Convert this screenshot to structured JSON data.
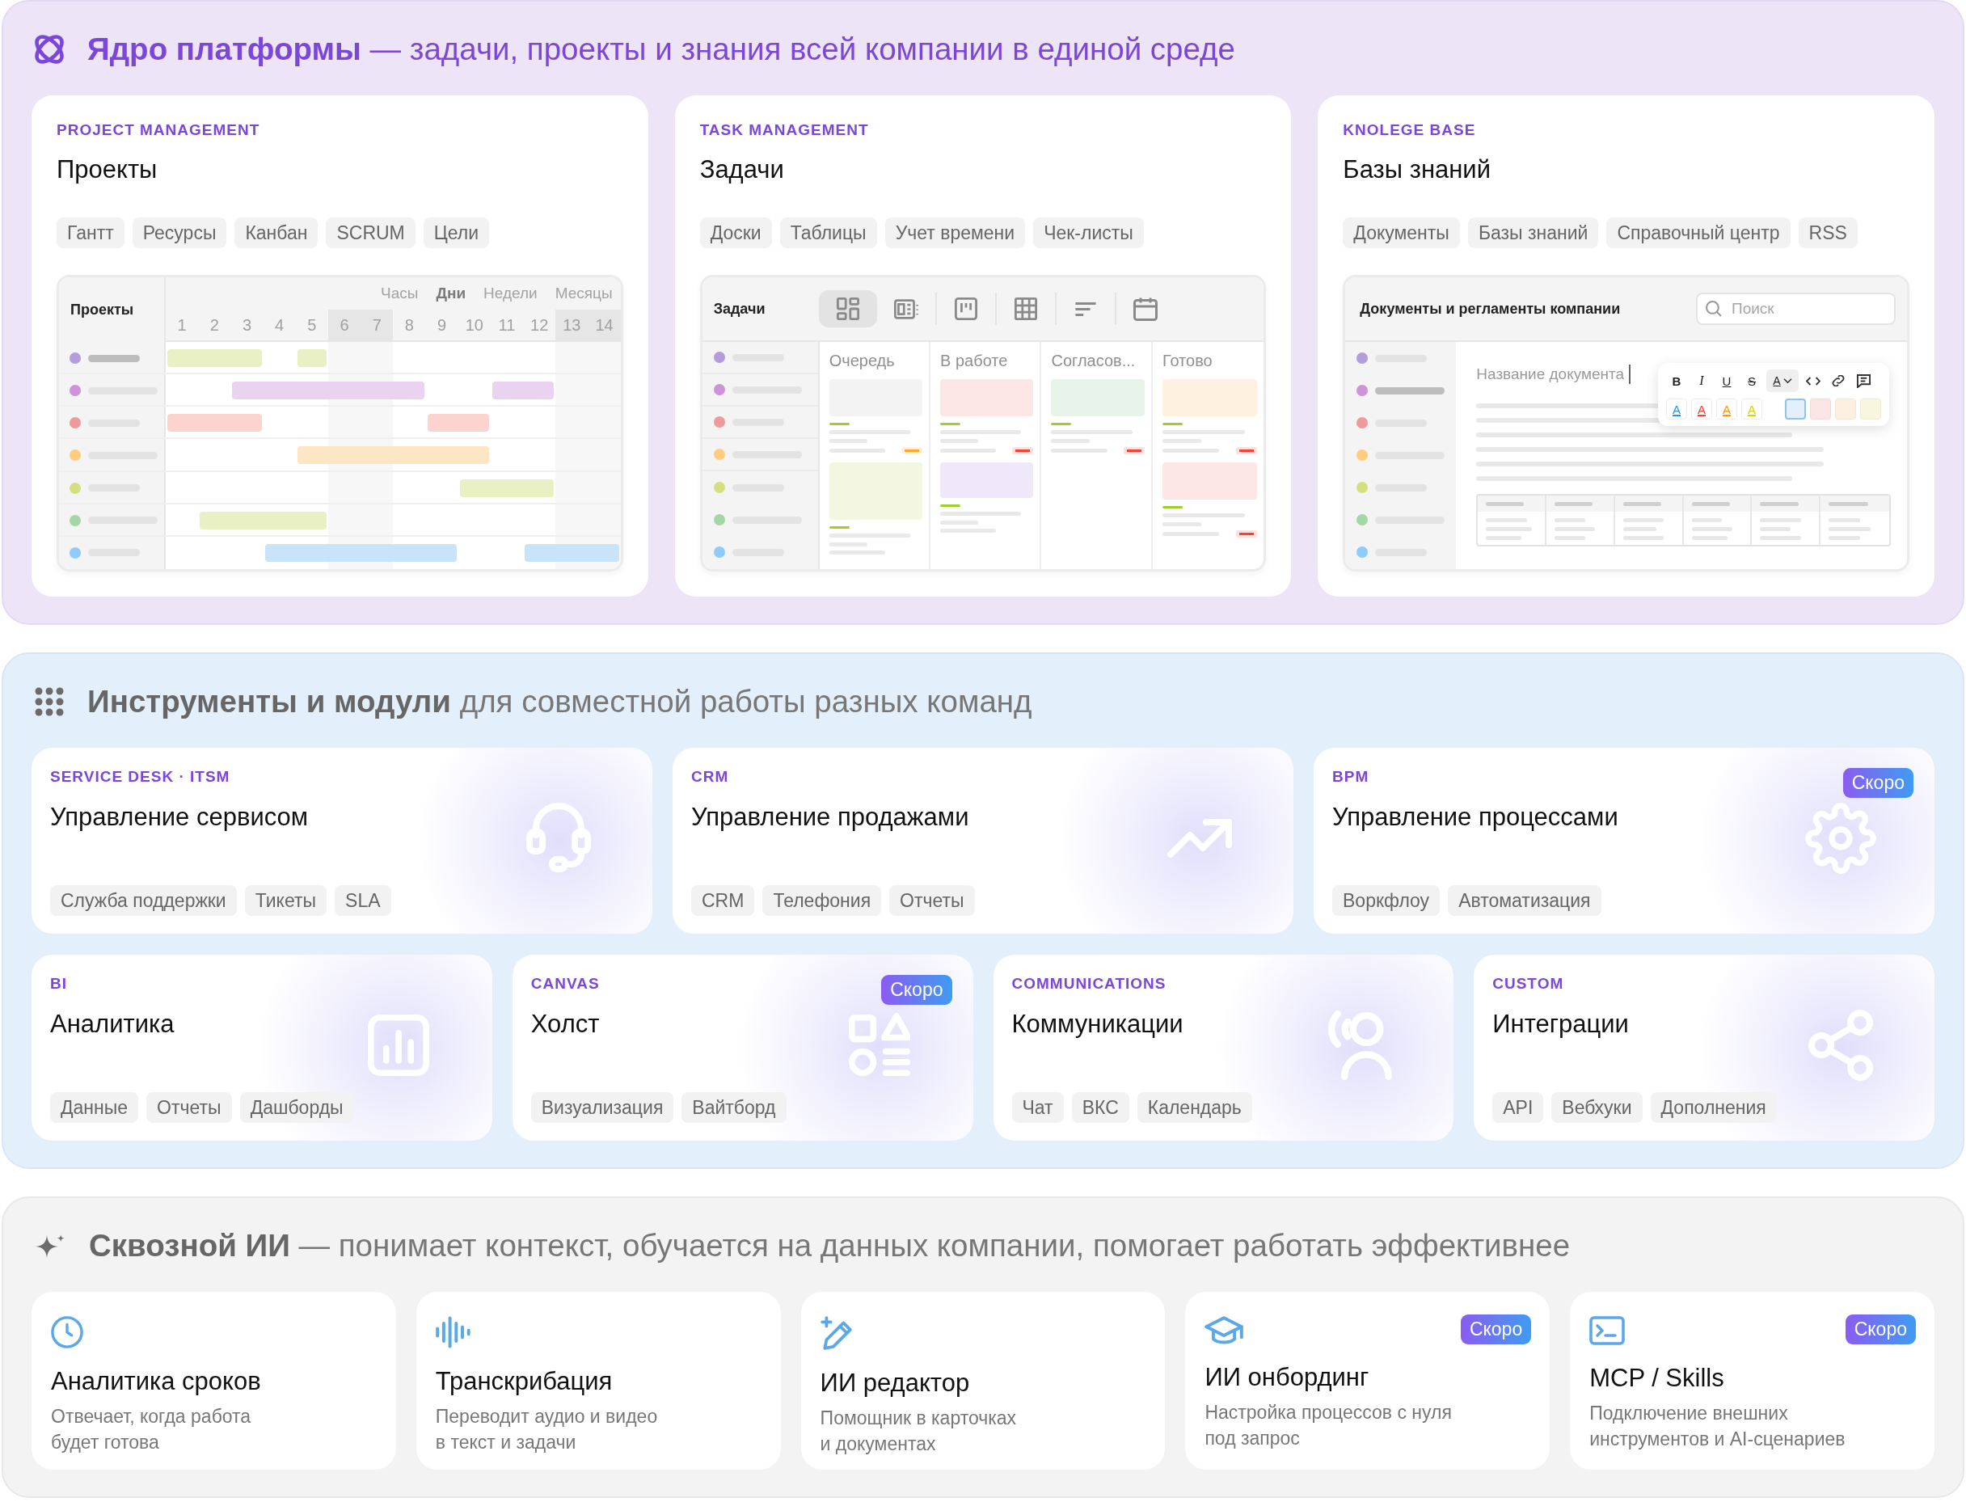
{
  "platform_core": {
    "heading": "**Ядро платформы** — задачи, проекты и знания всей компании в единой среде",
    "cards": [
      {
        "category": "PROJECT MANAGEMENT",
        "title": "Проекты",
        "tags": [
          "Гантт",
          "Ресурсы",
          "Канбан",
          "SCRUM",
          "Цели"
        ],
        "preview": {
          "kind": "gantt",
          "title": "Проекты",
          "scales": [
            {
              "label": "Часы",
              "selected": false
            },
            {
              "label": "Дни",
              "selected": true
            },
            {
              "label": "Недели",
              "selected": false
            },
            {
              "label": "Месяцы",
              "selected": false
            }
          ],
          "days": [
            {
              "label": "1",
              "weekend": false
            },
            {
              "label": "2",
              "weekend": false
            },
            {
              "label": "3",
              "weekend": false
            },
            {
              "label": "4",
              "weekend": false
            },
            {
              "label": "5",
              "weekend": false
            },
            {
              "label": "6",
              "weekend": true
            },
            {
              "label": "7",
              "weekend": true
            },
            {
              "label": "8",
              "weekend": false
            },
            {
              "label": "9",
              "weekend": false
            },
            {
              "label": "10",
              "weekend": false
            },
            {
              "label": "11",
              "weekend": false
            },
            {
              "label": "12",
              "weekend": false
            },
            {
              "label": "13",
              "weekend": true
            },
            {
              "label": "14",
              "weekend": true
            }
          ],
          "rows": [
            {
              "color": "#b39ddb",
              "selected": true,
              "bars": [
                {
                  "color": "#e8f0c4"
                },
                {
                  "color": "#e8f0c4"
                }
              ]
            },
            {
              "color": "#ce93d8",
              "selected": false,
              "bars": [
                {
                  "color": "#ead3ee"
                },
                {
                  "color": "#ead3ee"
                }
              ]
            },
            {
              "color": "#ef9a9a",
              "selected": false,
              "bars": [
                {
                  "color": "#fdd3d0"
                },
                {
                  "color": "#fdd3d0"
                }
              ]
            },
            {
              "color": "#ffcc80",
              "selected": false,
              "bars": [
                {
                  "color": "#fde6c4"
                }
              ]
            },
            {
              "color": "#d4e07f",
              "selected": false,
              "bars": [
                {
                  "color": "#e8f0c4"
                }
              ]
            },
            {
              "color": "#a5d6a7",
              "selected": false,
              "bars": [
                {
                  "color": "#e8f0c4"
                }
              ]
            },
            {
              "color": "#90caf9",
              "selected": false,
              "bars": [
                {
                  "color": "#c9e3f8"
                },
                {
                  "color": "#c9e3f8"
                }
              ]
            }
          ]
        }
      },
      {
        "category": "TASK MANAGEMENT",
        "title": "Задачи",
        "tags": [
          "Доски",
          "Таблицы",
          "Учет времени",
          "Чек-листы"
        ],
        "preview": {
          "kind": "kanban",
          "title": "Задачи",
          "views": [
            {
              "selected": true
            },
            {
              "selected": false
            },
            {
              "selected": false
            },
            {
              "selected": false
            },
            {
              "selected": false
            },
            {
              "selected": false
            }
          ],
          "rows": [
            {
              "color": "#b39ddb"
            },
            {
              "color": "#ce93d8"
            },
            {
              "color": "#ef9a9a"
            },
            {
              "color": "#ffcc80"
            },
            {
              "color": "#d4e07f"
            },
            {
              "color": "#a5d6a7"
            },
            {
              "color": "#90caf9"
            }
          ],
          "columns": [
            {
              "title": "Очередь",
              "cards": [
                {
                  "color": "#f3f3f3",
                  "flag": {
                    "color": "#ffa726"
                  }
                },
                {
                  "color": "#f3f7e1"
                }
              ]
            },
            {
              "title": "В работе",
              "cards": [
                {
                  "color": "#fde6e6",
                  "flag": {
                    "color": "#f44336"
                  }
                },
                {
                  "color": "#efe8fa"
                }
              ]
            },
            {
              "title": "Согласов...",
              "cards": [
                {
                  "color": "#e8f4ea",
                  "flag": {
                    "color": "#f44336"
                  }
                }
              ]
            },
            {
              "title": "Готово",
              "cards": [
                {
                  "color": "#fff1df",
                  "flag": {
                    "color": "#f44336"
                  }
                },
                {
                  "color": "#fde6e6",
                  "flag": {
                    "color": "#f44336"
                  }
                }
              ]
            }
          ]
        }
      },
      {
        "category": "KNOLEGE BASE",
        "title": "Базы знаний",
        "tags": [
          "Документы",
          "Базы знаний",
          "Справочный центр",
          "RSS"
        ],
        "preview": {
          "kind": "docs",
          "title": "Документы и регламенты компании",
          "search": {
            "placeholder": "Поиск"
          },
          "rows": [
            {
              "color": "#b39ddb",
              "selected": false
            },
            {
              "color": "#ce93d8",
              "selected": true
            },
            {
              "color": "#ef9a9a",
              "selected": false
            },
            {
              "color": "#ffcc80",
              "selected": false
            },
            {
              "color": "#d4e07f",
              "selected": false
            },
            {
              "color": "#a5d6a7",
              "selected": false
            },
            {
              "color": "#90caf9",
              "selected": false
            }
          ],
          "document": {
            "placeholder": "Название документа"
          },
          "toolbar": {
            "formats": [
              {
                "kind": "bold",
                "label": "B",
                "selected": false
              },
              {
                "kind": "italic",
                "label": "I",
                "selected": false
              },
              {
                "kind": "underline",
                "label": "U",
                "selected": false
              },
              {
                "kind": "strike",
                "label": "S",
                "selected": false
              },
              {
                "kind": "text-color",
                "label": "A",
                "selected": true
              },
              {
                "kind": "code",
                "selected": false
              },
              {
                "kind": "link",
                "selected": false
              },
              {
                "kind": "comment",
                "selected": false
              }
            ],
            "text_colors": [
              {
                "label": "A",
                "color": "#2196f3"
              },
              {
                "label": "A",
                "color": "#f44336"
              },
              {
                "label": "A",
                "color": "#ff9800"
              },
              {
                "label": "A",
                "color": "#e0d000"
              }
            ],
            "highlights": [
              {
                "color": "#e3effd",
                "selected": true
              },
              {
                "color": "#fbe4e4",
                "selected": false
              },
              {
                "color": "#fdf0e0",
                "selected": false
              },
              {
                "color": "#f8f6dc",
                "selected": false
              }
            ]
          }
        }
      }
    ]
  },
  "tools_and_modules": {
    "heading": "**Инструменты и модули** для совместной работы разных команд",
    "rows": [
      {
        "cards": [
          {
            "category": "SERVICE DESK · ITSM",
            "title": "Управление сервисом",
            "tags": [
              "Служба поддержки",
              "Тикеты",
              "SLA"
            ]
          },
          {
            "category": "CRM",
            "title": "Управление продажами",
            "tags": [
              "CRM",
              "Телефония",
              "Отчеты"
            ]
          },
          {
            "category": "BPM",
            "title": "Управление процессами",
            "tags": [
              "Воркфлоу",
              "Автоматизация"
            ],
            "badge": "Скоро"
          }
        ]
      },
      {
        "cards": [
          {
            "category": "BI",
            "title": "Аналитика",
            "tags": [
              "Данные",
              "Отчеты",
              "Дашборды"
            ]
          },
          {
            "category": "CANVAS",
            "title": "Холст",
            "tags": [
              "Визуализация",
              "Вайтборд"
            ],
            "badge": "Скоро"
          },
          {
            "category": "COMMUNICATIONS",
            "title": "Коммуникации",
            "tags": [
              "Чат",
              "ВКС",
              "Календарь"
            ]
          },
          {
            "category": "CUSTOM",
            "title": "Интеграции",
            "tags": [
              "API",
              "Вебхуки",
              "Дополнения"
            ]
          }
        ]
      }
    ]
  },
  "cross_cutting_ai": {
    "heading": "**Сквозной ИИ** — понимает контекст, обучается на данных компании, помогает работать эффективнее",
    "cards": [
      {
        "title": "Аналитика сроков",
        "description": "Отвечает, когда работа\nбудет готова"
      },
      {
        "title": "Транскрибация",
        "description": "Переводит аудио и видео\nв текст и задачи"
      },
      {
        "title": "ИИ редактор",
        "description": "Помощник в карточках\nи документах"
      },
      {
        "title": "ИИ онбординг",
        "description": "Настройка процессов с нуля\nпод запрос",
        "badge": "Скоро"
      },
      {
        "title": "MCP / Skills",
        "description": "Подключение внешних\nинструментов и AI-сценариев",
        "badge": "Скоро"
      }
    ]
  }
}
